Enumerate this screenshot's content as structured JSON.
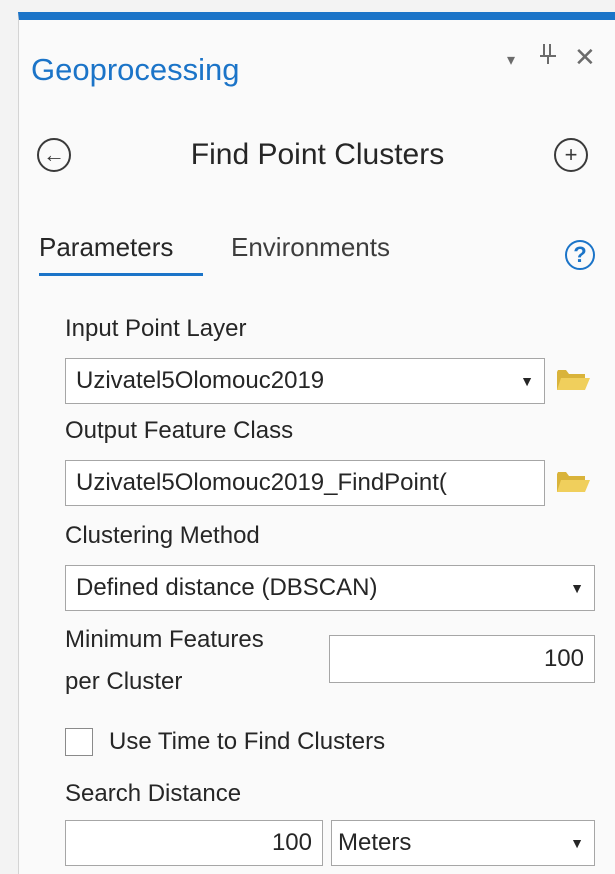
{
  "pane": {
    "title": "Geoprocessing",
    "menu_icon": "▾",
    "pin_icon": "⊥",
    "close_icon": "✕"
  },
  "tool": {
    "title": "Find Point Clusters",
    "back_icon": "←",
    "add_icon": "+"
  },
  "tabs": {
    "parameters": "Parameters",
    "environments": "Environments",
    "help_icon": "?"
  },
  "params": {
    "input_layer": {
      "label": "Input Point Layer",
      "value": "Uzivatel5Olomouc2019"
    },
    "output_class": {
      "label": "Output Feature Class",
      "value": "Uzivatel5Olomouc2019_FindPoint("
    },
    "clustering": {
      "label": "Clustering Method",
      "value": "Defined distance (DBSCAN)"
    },
    "min_features": {
      "label_line1": "Minimum Features",
      "label_line2": "per Cluster",
      "value": "100"
    },
    "use_time": {
      "label": "Use Time to Find Clusters",
      "checked": false
    },
    "search_distance": {
      "label": "Search Distance",
      "value": "100",
      "unit": "Meters"
    }
  },
  "colors": {
    "accent": "#1b74c8",
    "folder": "#e6c34a"
  }
}
